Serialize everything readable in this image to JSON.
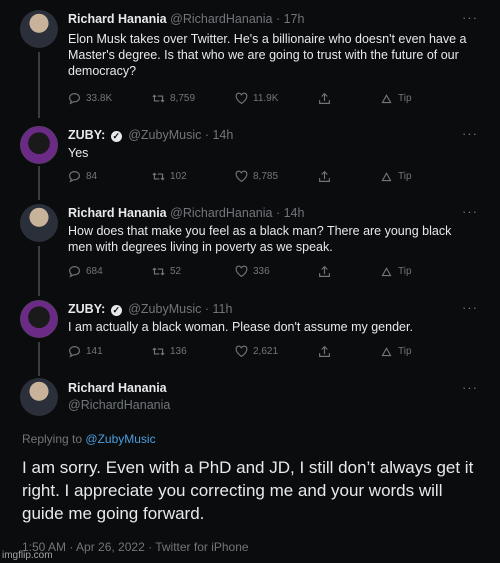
{
  "tweets": [
    {
      "name": "Richard Hanania",
      "handle": "@RichardHanania",
      "time": "· 17h",
      "text": "Elon Musk takes over Twitter. He's a billionaire who doesn't even have a Master's degree. Is that who we are going to trust with the future of our democracy?",
      "replies": "33.8K",
      "retweets": "8,759",
      "likes": "11.9K",
      "tip": "Tip"
    },
    {
      "name": "ZUBY:",
      "handle": "@ZubyMusic",
      "time": "· 14h",
      "text": "Yes",
      "replies": "84",
      "retweets": "102",
      "likes": "8,785",
      "tip": "Tip"
    },
    {
      "name": "Richard Hanania",
      "handle": "@RichardHanania",
      "time": "· 14h",
      "text": "How does that make you feel as a black man? There are young black men with degrees living in poverty as we speak.",
      "replies": "684",
      "retweets": "52",
      "likes": "336",
      "tip": "Tip"
    },
    {
      "name": "ZUBY:",
      "handle": "@ZubyMusic",
      "time": "· 11h",
      "text": "I am actually a black woman. Please don't assume my gender.",
      "replies": "141",
      "retweets": "136",
      "likes": "2,621",
      "tip": "Tip"
    }
  ],
  "main_tweet": {
    "name": "Richard Hanania",
    "handle": "@RichardHanania",
    "replying_prefix": "Replying to",
    "replying_to": "@ZubyMusic",
    "text": "I am sorry. Even with a PhD and JD, I still don’t always get it right. I appreciate you correcting me and your words will guide me going forward.",
    "meta": "1:50 AM · Apr 26, 2022 · Twitter for iPhone"
  },
  "watermark": "imgflip.com",
  "more_glyph": "···"
}
